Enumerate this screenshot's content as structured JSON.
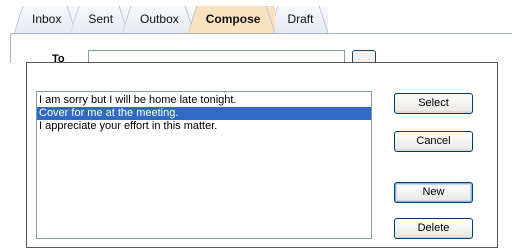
{
  "tabs": [
    {
      "label": "Inbox",
      "active": false
    },
    {
      "label": "Sent",
      "active": false
    },
    {
      "label": "Outbox",
      "active": false
    },
    {
      "label": "Compose",
      "active": true
    },
    {
      "label": "Draft",
      "active": false
    }
  ],
  "compose": {
    "to_label": "To"
  },
  "dialog": {
    "messages": [
      "I am sorry but I will be home late tonight.",
      "Cover for me at the meeting.",
      "I appreciate your effort in this matter."
    ],
    "selected_index": 1,
    "buttons": {
      "select": "Select",
      "cancel": "Cancel",
      "new": "New",
      "delete": "Delete"
    }
  },
  "colors": {
    "active_tab": "#f9e3bf",
    "selection": "#316ac5",
    "button_border": "#003c74"
  }
}
